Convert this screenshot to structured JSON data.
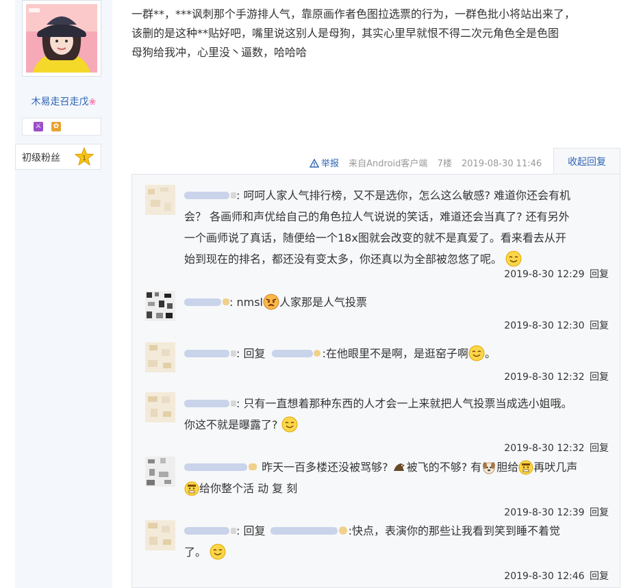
{
  "author": {
    "username": "木易走召走戊",
    "level_label": "初级粉丝",
    "level_number": "1",
    "badge_icons": [
      "sword-badge-icon",
      "flower-badge-icon"
    ]
  },
  "post": {
    "lines": [
      "一群**，***讽刺那个手游排人气，靠原画作者色图拉选票的行为，一群色批小将站出来了，",
      "该删的是这种**贴好吧，嘴里说这别人是母狗，其实心里早就恨不得二次元角色全是色图",
      "母狗给我冲，心里没丶逼数，哈哈哈"
    ],
    "report_label": "举报",
    "source": "来自Android客户端",
    "floor": "7楼",
    "time": "2019-08-30 11:46",
    "collapse_label": "收起回复"
  },
  "replies": [
    {
      "lines": [
        ": 呵呵人家人气排行榜，又不是选你，怎么这么敏感? 难道你还会有机",
        "会？ 各画师和声优给自己的角色拉人气说说的笑话，难道还会当真了? 还有另外",
        "一个画师说了真话，随便给一个18x图就会改变的就不是真爱了。看来看去从开",
        "始到现在的排名，都还没有变太多，你还真以为全部被忽悠了呢。"
      ],
      "emoji": "smile-emoji",
      "time": "2019-8-30 12:29",
      "reply_label": "回复"
    },
    {
      "text_a": ": nmsl",
      "text_b": "人家那是人气投票",
      "emoji": "angry-emoji",
      "time": "2019-8-30 12:30",
      "reply_label": "回复"
    },
    {
      "prefix": ": 回复",
      "text": ":在他眼里不是啊，是逛窑子啊",
      "suffix": "。",
      "emoji": "smile-emoji",
      "time": "2019-8-30 12:32",
      "reply_label": "回复"
    },
    {
      "lines": [
        ": 只有一直想着那种东西的人才会一上来就把人气投票当成选小姐哦。",
        "你这不就是曝露了?"
      ],
      "emoji": "smile-emoji",
      "time": "2019-8-30 12:32",
      "reply_label": "回复"
    },
    {
      "part1": "昨天一百多楼还没被骂够?",
      "part2": "被飞的不够? 有",
      "part3": "胆给",
      "part4": "再吠几声",
      "part5": "给你整个活 动 复 刻",
      "time": "2019-8-30 12:39",
      "reply_label": "回复"
    },
    {
      "prefix": ": 回复",
      "text": ":快点，表演你的那些让我看到笑到睡不着觉",
      "line2": "了。",
      "emoji": "smile-emoji",
      "time": "2019-8-30 12:46",
      "reply_label": "回复"
    }
  ],
  "colors": {
    "link": "#2d64b3",
    "panel_bg": "#f7f8fa",
    "sidebar_bg": "#f4f7fc",
    "meta_gray": "#999999"
  }
}
